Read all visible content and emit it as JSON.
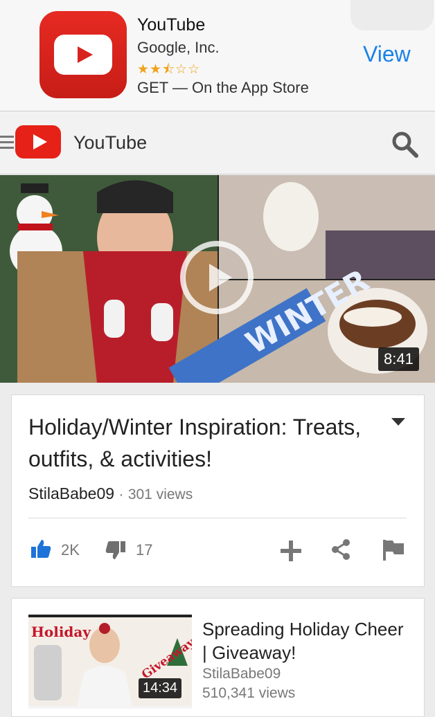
{
  "app_banner": {
    "close_glyph": "×",
    "app_name": "YouTube",
    "developer": "Google, Inc.",
    "rating_stars": "★★⯪☆☆",
    "store_text": "GET — On the App Store",
    "view_label": "View"
  },
  "header": {
    "title": "YouTube",
    "logo_color": "#e62117"
  },
  "video": {
    "duration": "8:41",
    "thumbnail_text": "WINTER",
    "title": "Holiday/Winter Inspiration: Treats, outfits, & activities!",
    "channel": "StilaBabe09",
    "separator": "·",
    "views": "301 views",
    "likes": "2K",
    "dislikes": "17"
  },
  "related": [
    {
      "title": "Spreading Holiday Cheer | Giveaway!",
      "channel": "StilaBabe09",
      "views": "510,341 views",
      "duration": "14:34",
      "thumb_text_1": "Holiday",
      "thumb_text_2": "Giveaway"
    }
  ],
  "colors": {
    "accent_blue": "#1a82e8",
    "brand_red": "#e62117",
    "like_blue": "#1e73d8",
    "star_orange": "#f0a21a"
  }
}
